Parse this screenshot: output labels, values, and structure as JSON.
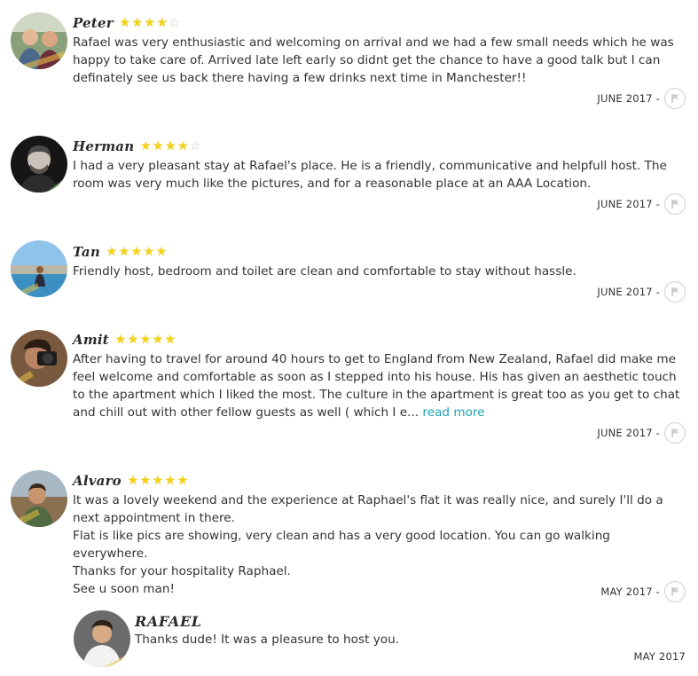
{
  "reviews": [
    {
      "name": "Peter",
      "rating": 4,
      "text": [
        "Rafael was very enthusiastic and welcoming on arrival and we had a few small needs which he was happy to take care of. Arrived late left early so didnt get the chance to have a good talk but I can definately see us back there having a few drinks next time in Manchester!!"
      ],
      "date": "JUNE 2017 -"
    },
    {
      "name": "Herman",
      "rating": 4,
      "text": [
        "I had a very pleasant stay at Rafael's place. He is a friendly, communicative and helpfull host. The room was very much like the pictures, and for a reasonable place at an AAA Location."
      ],
      "date": "JUNE 2017 -"
    },
    {
      "name": "Tan",
      "rating": 5,
      "text": [
        "Friendly host, bedroom and toilet are clean and comfortable to stay without hassle."
      ],
      "date": "JUNE 2017 -"
    },
    {
      "name": "Amit",
      "rating": 5,
      "text": [
        "After having to travel for around 40 hours to get to England from New Zealand, Rafael did make me feel welcome and comfortable as soon as I stepped into his house. His has given an aesthetic touch to the apartment which I liked the most. The culture in the apartment is great too as you get to chat and chill out with other fellow guests as well ( which I e..."
      ],
      "read_more": "read more",
      "date": "JUNE 2017 -"
    },
    {
      "name": "Alvaro",
      "rating": 5,
      "text": [
        "It was a lovely weekend and the experience at Raphael's flat it was really nice, and surely I'll do a next appointment in there.",
        "Flat is like pics are showing, very clean and has a very good location. You can go walking everywhere.",
        "Thanks for your hospitality Raphael.",
        "See u soon man!"
      ],
      "date": "MAY 2017 -"
    }
  ],
  "reply": {
    "name": "RAFAEL",
    "text": "Thanks dude! It was a pleasure to host you.",
    "date": "MAY 2017"
  },
  "icons": {
    "flag": "flag-icon",
    "star": "star-icon"
  },
  "colors": {
    "star_on": "#f2d21a",
    "star_off": "#c9c9c9",
    "link": "#1aa3b4"
  }
}
